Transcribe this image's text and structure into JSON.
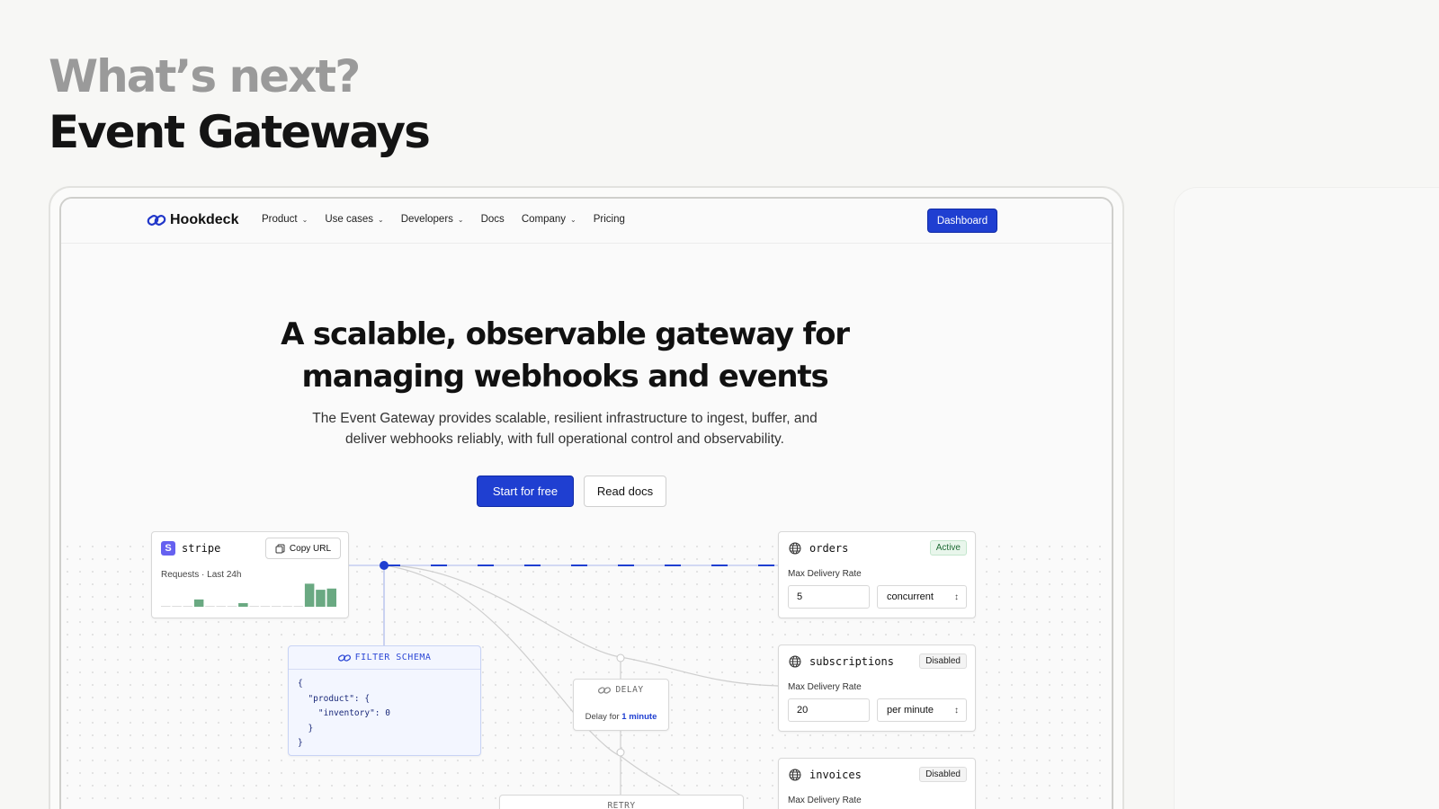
{
  "slide": {
    "eyebrow": "What’s next?",
    "title": "Event Gateways"
  },
  "nav": {
    "logo": "Hookdeck",
    "items": [
      {
        "label": "Product",
        "dropdown": true
      },
      {
        "label": "Use cases",
        "dropdown": true
      },
      {
        "label": "Developers",
        "dropdown": true
      },
      {
        "label": "Docs",
        "dropdown": false
      },
      {
        "label": "Company",
        "dropdown": true
      },
      {
        "label": "Pricing",
        "dropdown": false
      }
    ],
    "dashboard_label": "Dashboard"
  },
  "hero": {
    "title_line1": "A scalable, observable gateway for",
    "title_line2": "managing webhooks and events",
    "subtitle_line1": "The Event Gateway provides scalable, resilient infrastructure to ingest, buffer, and",
    "subtitle_line2": "deliver webhooks reliably, with full operational control and observability.",
    "primary_cta": "Start for free",
    "secondary_cta": "Read docs"
  },
  "source": {
    "badge": "S",
    "name": "stripe",
    "copy_label": "Copy URL",
    "requests_label": "Requests · Last 24h",
    "requests_series": [
      0,
      0,
      0,
      0.3,
      0,
      0,
      0,
      0.15,
      0,
      0,
      0,
      0,
      0,
      0.95,
      0.7,
      0.75
    ]
  },
  "filter": {
    "label": "FILTER SCHEMA",
    "code": "{\n  \"product\": {\n    \"inventory\": 0\n  }\n}"
  },
  "delay": {
    "label": "DELAY",
    "prefix": "Delay for",
    "value": "1 minute"
  },
  "retry": {
    "label": "RETRY"
  },
  "destinations": [
    {
      "name": "orders",
      "status": "Active",
      "rate_label": "Max Delivery Rate",
      "rate_value": "5",
      "rate_unit": "concurrent"
    },
    {
      "name": "subscriptions",
      "status": "Disabled",
      "rate_label": "Max Delivery Rate",
      "rate_value": "20",
      "rate_unit": "per minute"
    },
    {
      "name": "invoices",
      "status": "Disabled",
      "rate_label": "Max Delivery Rate",
      "rate_value": "",
      "rate_unit": ""
    }
  ],
  "colors": {
    "brand_blue": "#1f3fd1",
    "spark_green": "#6aa982",
    "active_green": "#1f6b35"
  },
  "icons": {
    "logo": "chain-link-icon",
    "dropdown": "chevron-down-icon",
    "copy": "copy-icon",
    "destination": "globe-icon",
    "filter": "link-icon",
    "select": "up-down-chevron-icon"
  }
}
